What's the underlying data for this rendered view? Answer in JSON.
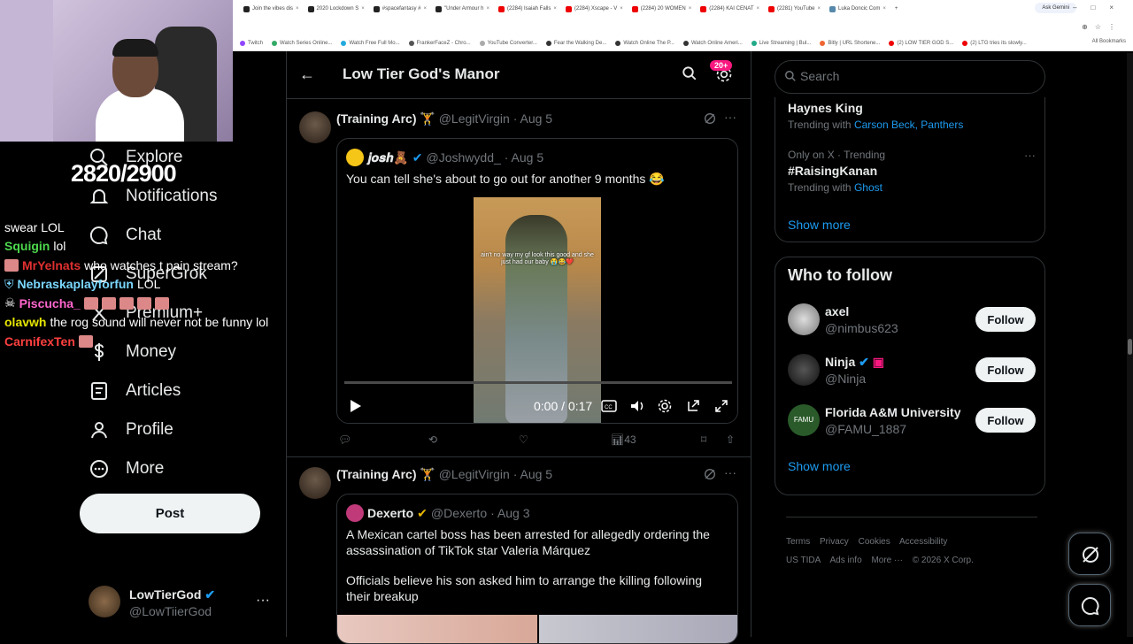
{
  "browser": {
    "tabs": [
      {
        "label": "Join the vibes dis",
        "icon": "tiktok-icon"
      },
      {
        "label": "2020 Lockdown S",
        "icon": "tiktok-icon"
      },
      {
        "label": "#spacefantasy #",
        "icon": "tiktok-icon"
      },
      {
        "label": "\"Under Armour h",
        "icon": "tiktok-icon"
      },
      {
        "label": "(2284) Isaiah Falls",
        "icon": "youtube-icon"
      },
      {
        "label": "(2284) Xscape - V",
        "icon": "youtube-icon"
      },
      {
        "label": "(2284) 20 WOMEN",
        "icon": "youtube-icon"
      },
      {
        "label": "(2284) KAI CENAT",
        "icon": "youtube-icon"
      },
      {
        "label": "(2281) YouTube",
        "icon": "youtube-icon"
      },
      {
        "label": "Luka Doncic Com",
        "icon": "page-icon"
      }
    ],
    "ask_label": "Ask Gemini",
    "bookmarks": [
      "Twitch",
      "Watch Series Online...",
      "Watch Free Full Mo...",
      "FrankerFaceZ - Chro...",
      "YouTube Converter...",
      "Fear the Walking De...",
      "Watch Online The P...",
      "Watch Online Ameri...",
      "Live Streaming | Bul...",
      "Bitly | URL Shortene...",
      "(2) LOW TIER GOD S...",
      "(2) LTG tries its slowly..."
    ],
    "all_bookmarks": "All Bookmarks"
  },
  "overlay": {
    "score": "2820/2900",
    "chat": [
      {
        "user": "",
        "color": "#ffffff",
        "message": "swear LOL"
      },
      {
        "user": "Squigin",
        "color": "#4dd84d",
        "message": "lol"
      },
      {
        "user": "MrYelnats",
        "color": "#e03030",
        "message": "who watches t pain stream?"
      },
      {
        "user": "Nebraskaplayforfun",
        "color": "#7ad7ff",
        "message": "LOL"
      },
      {
        "user": "Piscucha_",
        "color": "#ff66cc",
        "message": ""
      },
      {
        "user": "olavwh",
        "color": "#e6e600",
        "message": "the rog sound will never not be funny lol"
      },
      {
        "user": "CarnifexTen",
        "color": "#ff4040",
        "message": ""
      }
    ]
  },
  "nav": {
    "items": [
      {
        "label": "Explore",
        "icon": "search-icon"
      },
      {
        "label": "Notifications",
        "icon": "bell-icon"
      },
      {
        "label": "Chat",
        "icon": "chat-icon"
      },
      {
        "label": "SuperGrok",
        "icon": "grok-icon"
      },
      {
        "label": "Premium+",
        "icon": "x-icon"
      },
      {
        "label": "Money",
        "icon": "dollar-icon"
      },
      {
        "label": "Articles",
        "icon": "article-icon"
      },
      {
        "label": "Profile",
        "icon": "person-icon"
      },
      {
        "label": "More",
        "icon": "more-circle-icon"
      }
    ],
    "post_label": "Post",
    "account": {
      "name": "LowTierGod",
      "handle": "@LowTiierGod"
    }
  },
  "main": {
    "title": "Low Tier God's Manor",
    "badge": "20+",
    "posts": [
      {
        "author": "(Training Arc) 🏋️",
        "handle": "@LegitVirgin",
        "date": "· Aug 5",
        "quote": {
          "author": "𝒋𝒐𝒔𝒉🧸",
          "handle": "@Joshwydd_",
          "date": "· Aug 5",
          "text": "You can tell she's about to go out for another 9 months 😂",
          "video": {
            "caption": "ain't no way my gf look this good and she just had our baby 😭😂❤️",
            "time": "0:00 / 0:17",
            "progress": 0
          }
        },
        "views": "43"
      },
      {
        "author": "(Training Arc) 🏋️",
        "handle": "@LegitVirgin",
        "date": "· Aug 5",
        "quote": {
          "author": "Dexerto",
          "handle": "@Dexerto",
          "date": "· Aug 3",
          "text": "A Mexican cartel boss has been arrested for allegedly ordering the assassination of TikTok star Valeria Márquez",
          "text2": "Officials believe his son asked him to arrange the killing following their breakup"
        }
      }
    ]
  },
  "right": {
    "search_placeholder": "Search",
    "trends": [
      {
        "name": "Haynes King",
        "with_label": "Trending with",
        "with": "Carson Beck, Panthers"
      },
      {
        "meta": "Only on X · Trending",
        "name": "#RaisingKanan",
        "with_label": "Trending with",
        "with": "Ghost"
      }
    ],
    "show_more": "Show more",
    "who_to_follow": {
      "title": "Who to follow",
      "accounts": [
        {
          "name": "axel",
          "handle": "@nimbus623",
          "button": "Follow"
        },
        {
          "name": "Ninja",
          "handle": "@Ninja",
          "button": "Follow"
        },
        {
          "name": "Florida A&M University",
          "handle": "@FAMU_1887",
          "button": "Follow"
        }
      ],
      "show_more": "Show more"
    },
    "footer": [
      "Terms",
      "Privacy",
      "Cookies",
      "Accessibility",
      "US TIDA",
      "Ads info",
      "More ···",
      "© 2026 X Corp."
    ]
  }
}
